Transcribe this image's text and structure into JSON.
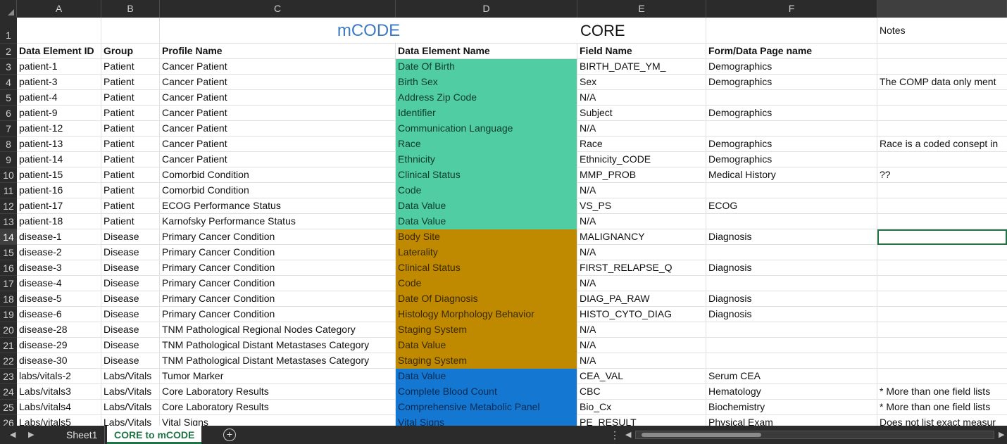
{
  "columns": [
    "A",
    "B",
    "C",
    "D",
    "E",
    "F",
    ""
  ],
  "rows": [
    {
      "num": "1",
      "a": "",
      "b": "",
      "c": "mCODE",
      "d": "",
      "e": "CORE",
      "f": "",
      "g": "Notes",
      "bg": ""
    },
    {
      "num": "2",
      "a": "Data Element ID",
      "b": "Group",
      "c": "Profile Name",
      "d": "Data Element Name",
      "e": "Field Name",
      "f": "Form/Data Page name",
      "g": "",
      "bg": ""
    },
    {
      "num": "3",
      "a": "patient-1",
      "b": "Patient",
      "c": "Cancer Patient",
      "d": "Date Of Birth",
      "e": "BIRTH_DATE_YM_",
      "f": "Demographics",
      "g": "",
      "bg": "teal"
    },
    {
      "num": "4",
      "a": "patient-3",
      "b": "Patient",
      "c": "Cancer Patient",
      "d": "Birth Sex",
      "e": "Sex",
      "f": "Demographics",
      "g": "The COMP data only ment",
      "bg": "teal"
    },
    {
      "num": "5",
      "a": "patient-4",
      "b": "Patient",
      "c": "Cancer Patient",
      "d": "Address Zip Code",
      "e": "N/A",
      "f": "",
      "g": "",
      "bg": "teal"
    },
    {
      "num": "6",
      "a": "patient-9",
      "b": "Patient",
      "c": "Cancer Patient",
      "d": "Identifier",
      "e": "Subject",
      "f": "Demographics",
      "g": "",
      "bg": "teal"
    },
    {
      "num": "7",
      "a": "patient-12",
      "b": "Patient",
      "c": "Cancer Patient",
      "d": "Communication Language",
      "e": "N/A",
      "f": "",
      "g": "",
      "bg": "teal"
    },
    {
      "num": "8",
      "a": "patient-13",
      "b": "Patient",
      "c": "Cancer Patient",
      "d": "Race",
      "e": "Race",
      "f": "Demographics",
      "g": "Race is a coded consept in",
      "bg": "teal"
    },
    {
      "num": "9",
      "a": "patient-14",
      "b": "Patient",
      "c": "Cancer Patient",
      "d": "Ethnicity",
      "e": "Ethnicity_CODE",
      "f": "Demographics",
      "g": "",
      "bg": "teal"
    },
    {
      "num": "10",
      "a": "patient-15",
      "b": "Patient",
      "c": "Comorbid Condition",
      "d": "Clinical Status",
      "e": "MMP_PROB",
      "f": "Medical History",
      "g": " ??",
      "bg": "teal"
    },
    {
      "num": "11",
      "a": "patient-16",
      "b": "Patient",
      "c": "Comorbid Condition",
      "d": "Code",
      "e": "N/A",
      "f": "",
      "g": "",
      "bg": "teal"
    },
    {
      "num": "12",
      "a": "patient-17",
      "b": "Patient",
      "c": "ECOG Performance Status",
      "d": "Data Value",
      "e": "VS_PS",
      "f": "ECOG",
      "g": "",
      "bg": "teal"
    },
    {
      "num": "13",
      "a": "patient-18",
      "b": "Patient",
      "c": "Karnofsky Performance Status",
      "d": "Data Value",
      "e": "N/A",
      "f": "",
      "g": "",
      "bg": "teal"
    },
    {
      "num": "14",
      "a": "disease-1",
      "b": "Disease",
      "c": "Primary Cancer Condition",
      "d": "Body Site",
      "e": "MALIGNANCY",
      "f": "Diagnosis",
      "g": "",
      "bg": "gold"
    },
    {
      "num": "15",
      "a": "disease-2",
      "b": "Disease",
      "c": "Primary Cancer Condition",
      "d": "Laterality",
      "e": "N/A",
      "f": "",
      "g": "",
      "bg": "gold"
    },
    {
      "num": "16",
      "a": "disease-3",
      "b": "Disease",
      "c": "Primary Cancer Condition",
      "d": "Clinical Status",
      "e": "FIRST_RELAPSE_Q",
      "f": "Diagnosis",
      "g": "",
      "bg": "gold"
    },
    {
      "num": "17",
      "a": "disease-4",
      "b": "Disease",
      "c": "Primary Cancer Condition",
      "d": "Code",
      "e": "N/A",
      "f": "",
      "g": "",
      "bg": "gold"
    },
    {
      "num": "18",
      "a": "disease-5",
      "b": "Disease",
      "c": "Primary Cancer Condition",
      "d": "Date Of Diagnosis",
      "e": "DIAG_PA_RAW",
      "f": "Diagnosis",
      "g": "",
      "bg": "gold"
    },
    {
      "num": "19",
      "a": "disease-6",
      "b": "Disease",
      "c": "Primary Cancer Condition",
      "d": "Histology Morphology Behavior",
      "e": "HISTO_CYTO_DIAG",
      "f": "Diagnosis",
      "g": "",
      "bg": "gold"
    },
    {
      "num": "20",
      "a": "disease-28",
      "b": "Disease",
      "c": "TNM Pathological Regional Nodes Category",
      "d": "Staging System",
      "e": "N/A",
      "f": "",
      "g": "",
      "bg": "gold"
    },
    {
      "num": "21",
      "a": "disease-29",
      "b": "Disease",
      "c": "TNM Pathological Distant Metastases Category",
      "d": "Data Value",
      "e": "N/A",
      "f": "",
      "g": "",
      "bg": "gold"
    },
    {
      "num": "22",
      "a": "disease-30",
      "b": "Disease",
      "c": "TNM Pathological Distant Metastases Category",
      "d": "Staging System",
      "e": "N/A",
      "f": "",
      "g": "",
      "bg": "gold"
    },
    {
      "num": "23",
      "a": "labs/vitals-2",
      "b": "Labs/Vitals",
      "c": "Tumor Marker",
      "d": "Data Value",
      "e": "CEA_VAL",
      "f": "Serum CEA",
      "g": "",
      "bg": "blue"
    },
    {
      "num": "24",
      "a": "Labs/vitals3",
      "b": "Labs/Vitals",
      "c": "Core Laboratory Results",
      "d": "Complete Blood Count",
      "e": "CBC",
      "f": "Hematology",
      "g": "* More than one field lists",
      "bg": "blue"
    },
    {
      "num": "25",
      "a": "Labs/vitals4",
      "b": "Labs/Vitals",
      "c": "Core Laboratory Results",
      "d": "Comprehensive Metabolic Panel",
      "e": "Bio_Cx",
      "f": "Biochemistry",
      "g": "* More than one field lists",
      "bg": "blue"
    },
    {
      "num": "26",
      "a": "Labs/vitals5",
      "b": "Labs/Vitals",
      "c": "Vital Signs",
      "d": "Vital Signs",
      "e": "PE_RESULT",
      "f": "Physical Exam",
      "g": "Does not list exact measur",
      "bg": "blue"
    }
  ],
  "selected_row": "14",
  "tabs": [
    {
      "label": "Sheet1",
      "active": false
    },
    {
      "label": "CORE to mCODE",
      "active": true
    }
  ],
  "colors": {
    "teal": "#51cda4",
    "gold": "#bf8a00",
    "blue": "#1478d2",
    "accent": "#217346",
    "title_blue": "#3d7ac2"
  },
  "icons": {
    "add_sheet": "plus-circle-icon",
    "prev": "triangle-left-icon",
    "next": "triangle-right-icon"
  }
}
